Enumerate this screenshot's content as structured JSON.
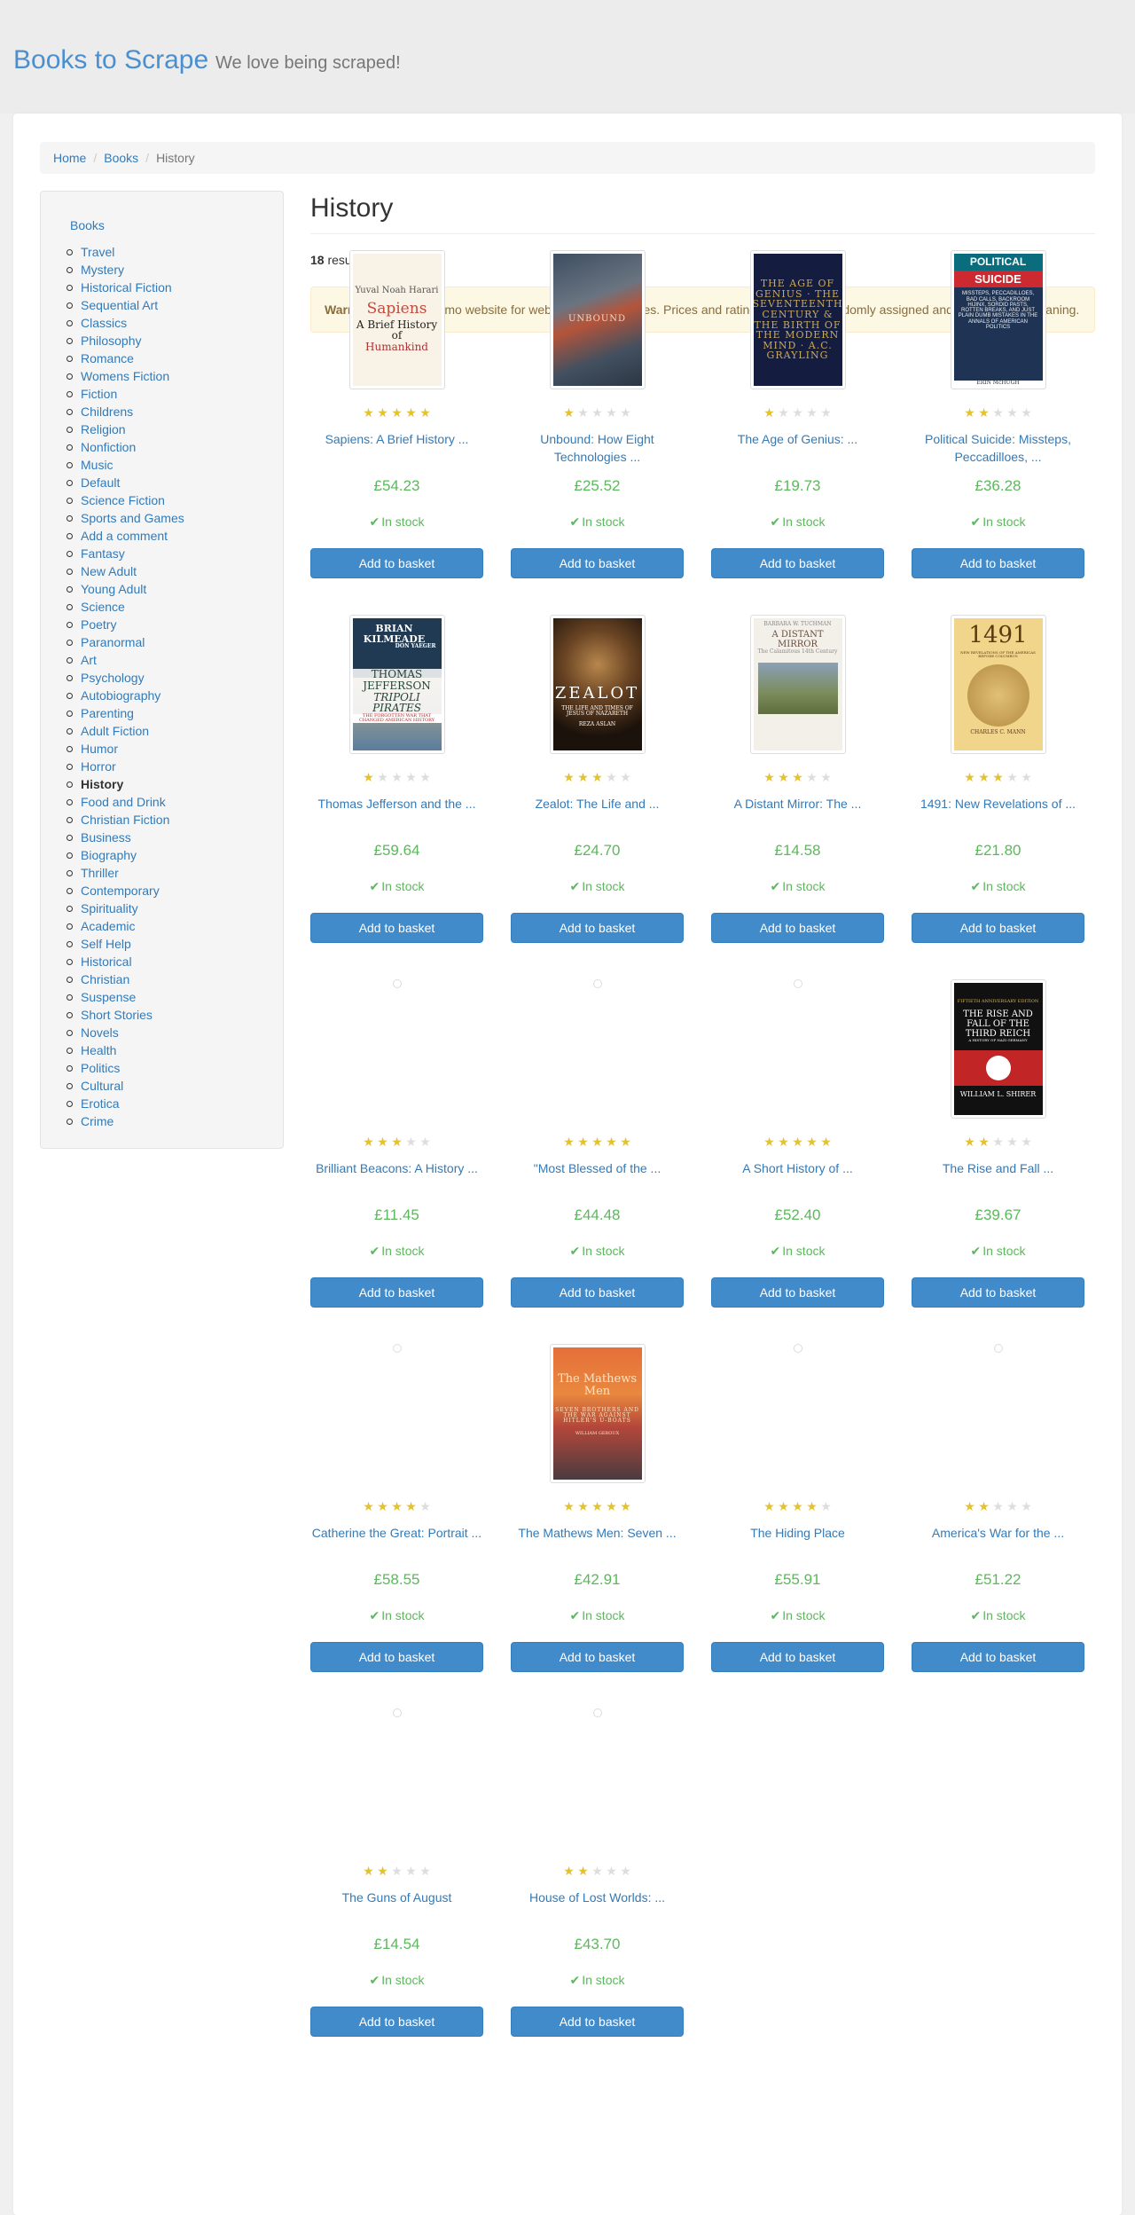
{
  "header": {
    "site_title": "Books to Scrape",
    "tagline": "We love being scraped!"
  },
  "breadcrumb": [
    "Home",
    "Books",
    "History"
  ],
  "sidebar": {
    "root": "Books",
    "current": "History",
    "categories": [
      "Travel",
      "Mystery",
      "Historical Fiction",
      "Sequential Art",
      "Classics",
      "Philosophy",
      "Romance",
      "Womens Fiction",
      "Fiction",
      "Childrens",
      "Religion",
      "Nonfiction",
      "Music",
      "Default",
      "Science Fiction",
      "Sports and Games",
      "Add a comment",
      "Fantasy",
      "New Adult",
      "Young Adult",
      "Science",
      "Poetry",
      "Paranormal",
      "Art",
      "Psychology",
      "Autobiography",
      "Parenting",
      "Adult Fiction",
      "Humor",
      "Horror",
      "History",
      "Food and Drink",
      "Christian Fiction",
      "Business",
      "Biography",
      "Thriller",
      "Contemporary",
      "Spirituality",
      "Academic",
      "Self Help",
      "Historical",
      "Christian",
      "Suspense",
      "Short Stories",
      "Novels",
      "Health",
      "Politics",
      "Cultural",
      "Erotica",
      "Crime"
    ]
  },
  "main": {
    "title": "History",
    "results_count": "18",
    "results_suffix": " results.",
    "warning_label": "Warning!",
    "warning_text": " This is a demo website for web scraping purposes. Prices and ratings here were randomly assigned and have no real meaning."
  },
  "products": [
    {
      "title": "Sapiens: A Brief History ...",
      "price": "£54.23",
      "rating": 5,
      "stock": "In stock",
      "button": "Add to basket",
      "cover": "sapiens"
    },
    {
      "title": "Unbound: How Eight Technologies ...",
      "price": "£25.52",
      "rating": 1,
      "stock": "In stock",
      "button": "Add to basket",
      "cover": "unbound"
    },
    {
      "title": "The Age of Genius: ...",
      "price": "£19.73",
      "rating": 1,
      "stock": "In stock",
      "button": "Add to basket",
      "cover": "genius"
    },
    {
      "title": "Political Suicide: Missteps, Peccadilloes, ...",
      "price": "£36.28",
      "rating": 2,
      "stock": "In stock",
      "button": "Add to basket",
      "cover": "political"
    },
    {
      "title": "Thomas Jefferson and the ...",
      "price": "£59.64",
      "rating": 1,
      "stock": "In stock",
      "button": "Add to basket",
      "cover": "thomas"
    },
    {
      "title": "Zealot: The Life and ...",
      "price": "£24.70",
      "rating": 3,
      "stock": "In stock",
      "button": "Add to basket",
      "cover": "zealot"
    },
    {
      "title": "A Distant Mirror: The ...",
      "price": "£14.58",
      "rating": 3,
      "stock": "In stock",
      "button": "Add to basket",
      "cover": "mirror"
    },
    {
      "title": "1491: New Revelations of ...",
      "price": "£21.80",
      "rating": 3,
      "stock": "In stock",
      "button": "Add to basket",
      "cover": "1491"
    },
    {
      "title": "Brilliant Beacons: A History ...",
      "price": "£11.45",
      "rating": 3,
      "stock": "In stock",
      "button": "Add to basket",
      "cover": ""
    },
    {
      "title": "\"Most Blessed of the ...",
      "price": "£44.48",
      "rating": 5,
      "stock": "In stock",
      "button": "Add to basket",
      "cover": ""
    },
    {
      "title": "A Short History of ...",
      "price": "£52.40",
      "rating": 5,
      "stock": "In stock",
      "button": "Add to basket",
      "cover": ""
    },
    {
      "title": "The Rise and Fall ...",
      "price": "£39.67",
      "rating": 2,
      "stock": "In stock",
      "button": "Add to basket",
      "cover": "reich"
    },
    {
      "title": "Catherine the Great: Portrait ...",
      "price": "£58.55",
      "rating": 4,
      "stock": "In stock",
      "button": "Add to basket",
      "cover": ""
    },
    {
      "title": "The Mathews Men: Seven ...",
      "price": "£42.91",
      "rating": 5,
      "stock": "In stock",
      "button": "Add to basket",
      "cover": "mathews"
    },
    {
      "title": "The Hiding Place",
      "price": "£55.91",
      "rating": 4,
      "stock": "In stock",
      "button": "Add to basket",
      "cover": ""
    },
    {
      "title": "America's War for the ...",
      "price": "£51.22",
      "rating": 2,
      "stock": "In stock",
      "button": "Add to basket",
      "cover": ""
    },
    {
      "title": "The Guns of August",
      "price": "£14.54",
      "rating": 2,
      "stock": "In stock",
      "button": "Add to basket",
      "cover": ""
    },
    {
      "title": "House of Lost Worlds: ...",
      "price": "£43.70",
      "rating": 2,
      "stock": "In stock",
      "button": "Add to basket",
      "cover": ""
    }
  ],
  "covers": {
    "sapiens": [
      "Yuval Noah Harari",
      "Sapiens",
      "A Brief History of",
      "Humankind"
    ],
    "unbound": [
      "UNBOUND"
    ],
    "genius": [
      "THE AGE OF GENIUS · THE SEVENTEENTH CENTURY & THE BIRTH OF THE MODERN MIND · A.C. GRAYLING"
    ],
    "political": [
      "POLITICAL",
      "SUICIDE",
      "MISSTEPS, PECCADILLOES, BAD CALLS, BACKROOM HIJINX, SORDID PASTS, ROTTEN BREAKS, AND JUST PLAIN DUMB MISTAKES IN THE ANNALS OF AMERICAN POLITICS",
      "ERIN McHUGH"
    ],
    "thomas": [
      "BRIAN KILMEADE",
      "DON YAEGER",
      "THOMAS JEFFERSON",
      "TRIPOLI PIRATES",
      "THE FORGOTTEN WAR THAT CHANGED AMERICAN HISTORY"
    ],
    "zealot": [
      "ZEALOT",
      "THE LIFE AND TIMES OF JESUS OF NAZARETH",
      "REZA ASLAN"
    ],
    "mirror": [
      "BARBARA W. TUCHMAN",
      "A DISTANT MIRROR",
      "The Calamitous 14th Century"
    ],
    "1491": [
      "1491",
      "NEW REVELATIONS OF THE AMERICAS BEFORE COLUMBUS",
      "CHARLES C. MANN"
    ],
    "reich": [
      "FIFTIETH ANNIVERSARY EDITION",
      "THE RISE AND FALL OF THE THIRD REICH",
      "A HISTORY OF NAZI GERMANY",
      "WILLIAM L. SHIRER"
    ],
    "mathews": [
      "The Mathews Men",
      "SEVEN BROTHERS AND THE WAR AGAINST HITLER'S U-BOATS",
      "WILLIAM GEROUX"
    ]
  },
  "colors": {
    "link": "#337ab7",
    "brand": "#4a90d0",
    "price": "#5cb85c",
    "star_on": "#e6c229",
    "star_off": "#dddddd",
    "button": "#428bca",
    "warning_bg": "#fcf8e3"
  },
  "icons": {
    "star": "star-icon",
    "stock_check": "checkmark-icon"
  }
}
